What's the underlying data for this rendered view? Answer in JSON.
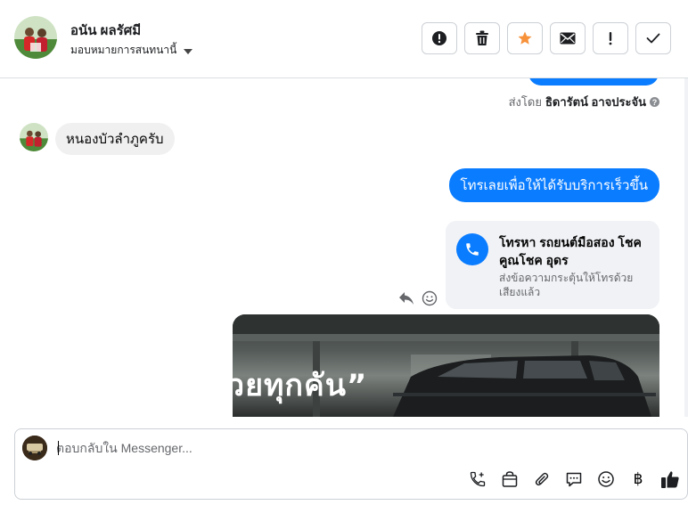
{
  "header": {
    "contact_name": "อนัน ผลรัศมี",
    "assign_label": "มอบหมายการสนทนานี้",
    "toolbar": [
      {
        "name": "spam-button",
        "icon": "alert-circle-icon"
      },
      {
        "name": "delete-button",
        "icon": "trash-icon"
      },
      {
        "name": "star-button",
        "icon": "star-icon"
      },
      {
        "name": "mark-unread-button",
        "icon": "envelope-icon"
      },
      {
        "name": "follow-up-button",
        "icon": "exclamation-icon"
      },
      {
        "name": "mark-done-button",
        "icon": "check-icon"
      }
    ],
    "accent_star": "#f7923b"
  },
  "messages": {
    "sent_by_prefix": "ส่งโดย",
    "sent_by_name": "ธิดารัตน์ อาจประจัน",
    "incoming_text": "หนองบัวลำภูครับ",
    "outgoing_text": "โทรเลยเพื่อให้ได้รับบริการเร็วขึ้น",
    "call_card": {
      "title": "โทรหา รถยนต์มือสอง โชคคูณโชค อุดร",
      "subtitle": "ส่งข้อความกระตุ้นให้โทรด้วยเสียงแล้ว"
    },
    "image_text": "วยทุกคัน”"
  },
  "composer": {
    "placeholder": "ตอบกลับใน Messenger...",
    "baht_symbol": "฿"
  },
  "colors": {
    "messenger_blue": "#0a7cff",
    "incoming_bg": "#f0f0f0",
    "border": "#ccd0d5"
  }
}
